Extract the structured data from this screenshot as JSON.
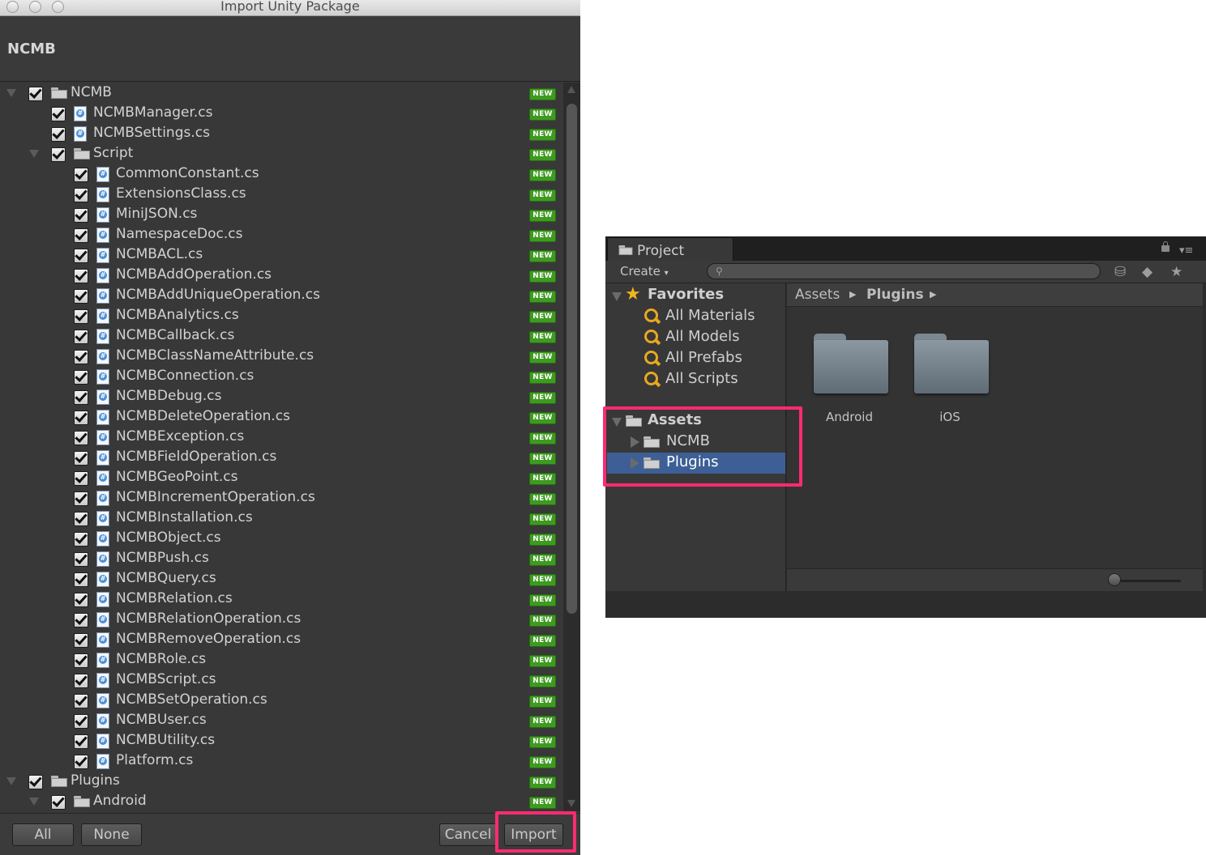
{
  "dialog": {
    "window_title": "Import Unity Package",
    "package_name": "NCMB",
    "new_badge": "NEW",
    "rows": [
      {
        "label": "NCMB",
        "type": "folder",
        "depth": 0,
        "expanded": true
      },
      {
        "label": "NCMBManager.cs",
        "type": "cs",
        "depth": 1
      },
      {
        "label": "NCMBSettings.cs",
        "type": "cs",
        "depth": 1
      },
      {
        "label": "Script",
        "type": "folder",
        "depth": 1,
        "expanded": true
      },
      {
        "label": "CommonConstant.cs",
        "type": "cs",
        "depth": 2
      },
      {
        "label": "ExtensionsClass.cs",
        "type": "cs",
        "depth": 2
      },
      {
        "label": "MiniJSON.cs",
        "type": "cs",
        "depth": 2
      },
      {
        "label": "NamespaceDoc.cs",
        "type": "cs",
        "depth": 2
      },
      {
        "label": "NCMBACL.cs",
        "type": "cs",
        "depth": 2
      },
      {
        "label": "NCMBAddOperation.cs",
        "type": "cs",
        "depth": 2
      },
      {
        "label": "NCMBAddUniqueOperation.cs",
        "type": "cs",
        "depth": 2
      },
      {
        "label": "NCMBAnalytics.cs",
        "type": "cs",
        "depth": 2
      },
      {
        "label": "NCMBCallback.cs",
        "type": "cs",
        "depth": 2
      },
      {
        "label": "NCMBClassNameAttribute.cs",
        "type": "cs",
        "depth": 2
      },
      {
        "label": "NCMBConnection.cs",
        "type": "cs",
        "depth": 2
      },
      {
        "label": "NCMBDebug.cs",
        "type": "cs",
        "depth": 2
      },
      {
        "label": "NCMBDeleteOperation.cs",
        "type": "cs",
        "depth": 2
      },
      {
        "label": "NCMBException.cs",
        "type": "cs",
        "depth": 2
      },
      {
        "label": "NCMBFieldOperation.cs",
        "type": "cs",
        "depth": 2
      },
      {
        "label": "NCMBGeoPoint.cs",
        "type": "cs",
        "depth": 2
      },
      {
        "label": "NCMBIncrementOperation.cs",
        "type": "cs",
        "depth": 2
      },
      {
        "label": "NCMBInstallation.cs",
        "type": "cs",
        "depth": 2
      },
      {
        "label": "NCMBObject.cs",
        "type": "cs",
        "depth": 2
      },
      {
        "label": "NCMBPush.cs",
        "type": "cs",
        "depth": 2
      },
      {
        "label": "NCMBQuery.cs",
        "type": "cs",
        "depth": 2
      },
      {
        "label": "NCMBRelation.cs",
        "type": "cs",
        "depth": 2
      },
      {
        "label": "NCMBRelationOperation.cs",
        "type": "cs",
        "depth": 2
      },
      {
        "label": "NCMBRemoveOperation.cs",
        "type": "cs",
        "depth": 2
      },
      {
        "label": "NCMBRole.cs",
        "type": "cs",
        "depth": 2
      },
      {
        "label": "NCMBScript.cs",
        "type": "cs",
        "depth": 2
      },
      {
        "label": "NCMBSetOperation.cs",
        "type": "cs",
        "depth": 2
      },
      {
        "label": "NCMBUser.cs",
        "type": "cs",
        "depth": 2
      },
      {
        "label": "NCMBUtility.cs",
        "type": "cs",
        "depth": 2
      },
      {
        "label": "Platform.cs",
        "type": "cs",
        "depth": 2
      },
      {
        "label": "Plugins",
        "type": "folder",
        "depth": 0,
        "expanded": true
      },
      {
        "label": "Android",
        "type": "folder",
        "depth": 1,
        "expanded": true
      }
    ],
    "buttons": {
      "all": "All",
      "none": "None",
      "cancel": "Cancel",
      "import": "Import"
    }
  },
  "project": {
    "tab_label": "Project",
    "create_label": "Create",
    "favorites": {
      "label": "Favorites",
      "items": [
        "All Materials",
        "All Models",
        "All Prefabs",
        "All Scripts"
      ]
    },
    "assets": {
      "label": "Assets",
      "children": [
        "NCMB",
        "Plugins"
      ],
      "selected": "Plugins"
    },
    "breadcrumb": [
      "Assets",
      "Plugins"
    ],
    "folders": [
      "Android",
      "iOS"
    ]
  },
  "colors": {
    "highlight": "#ff2a73",
    "new_badge": "#3d9b1f",
    "selection": "#3d5f95",
    "favorites_star": "#f2b51c"
  },
  "icons": {
    "file": "csharp-script-icon",
    "folder": "folder-icon",
    "favorite": "star-icon",
    "search_filter": "magnifier-icon"
  }
}
